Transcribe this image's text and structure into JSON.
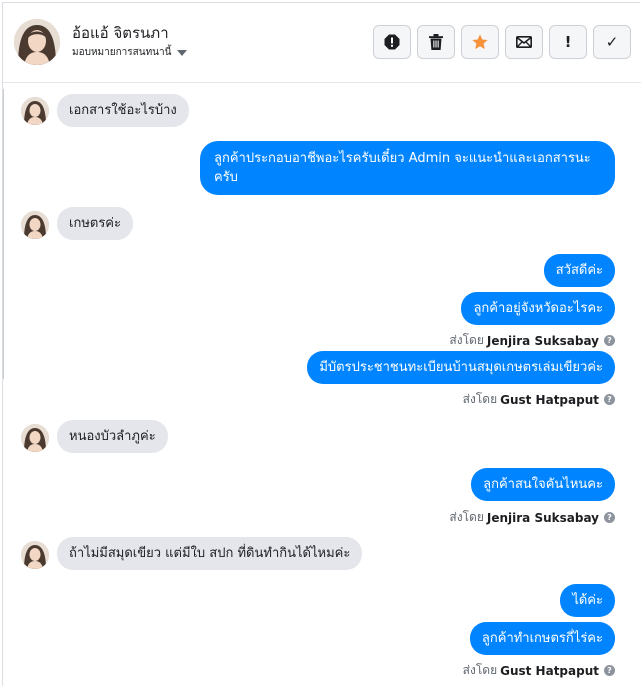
{
  "header": {
    "contact_name": "อ้อแอ้ จิตรนภา",
    "assign_label": "มอบหมายการสนทนานี้",
    "actions": [
      {
        "name": "report-spam-button",
        "icon": "alert-octagon-icon"
      },
      {
        "name": "delete-button",
        "icon": "trash-icon"
      },
      {
        "name": "star-button",
        "icon": "star-icon"
      },
      {
        "name": "mark-unread-button",
        "icon": "envelope-icon"
      },
      {
        "name": "follow-up-button",
        "icon": "exclamation-icon",
        "glyph": "!"
      },
      {
        "name": "mark-done-button",
        "icon": "check-icon",
        "glyph": "✓"
      }
    ],
    "colors": {
      "star": "#f7923a",
      "icon": "#1c1e21"
    }
  },
  "thread": {
    "sent_by_prefix": "ส่งโดย",
    "messages": [
      {
        "dir": "in",
        "text": "เอกสารใช้อะไรบ้าง"
      },
      {
        "dir": "out",
        "text": "ลูกค้าประกอบอาชีพอะไรครับเดี๋ยว Admin จะแนะนำและเอกสารนะครับ"
      },
      {
        "dir": "in",
        "text": "เกษตรค่ะ"
      },
      {
        "dir": "out",
        "text": "สวัสดีค่ะ"
      },
      {
        "dir": "out",
        "text": "ลูกค้าอยู่จังหวัดอะไรคะ",
        "sent_by": "Jenjira Suksabay"
      },
      {
        "dir": "out",
        "text": "มีบัตรประชาชนทะเบียนบ้านสมุดเกษตรเล่มเขียวค่ะ",
        "sent_by": "Gust Hatpaput"
      },
      {
        "dir": "in",
        "text": "หนองบัวลำภูค่ะ"
      },
      {
        "dir": "out",
        "text": "ลูกค้าสนใจคันไหนคะ",
        "sent_by": "Jenjira Suksabay"
      },
      {
        "dir": "in",
        "text": "ถ้าไม่มีสมุดเขียว แต่มีใบ สปก ที่ดินทำกินได้ไหมค่ะ"
      },
      {
        "dir": "out",
        "text": "ได้ค่ะ"
      },
      {
        "dir": "out",
        "text": "ลูกค้าทำเกษตรกี่ไร่คะ",
        "sent_by": "Gust Hatpaput"
      }
    ],
    "colors": {
      "incoming_bg": "#e4e6eb",
      "outgoing_bg": "#0084ff"
    }
  }
}
